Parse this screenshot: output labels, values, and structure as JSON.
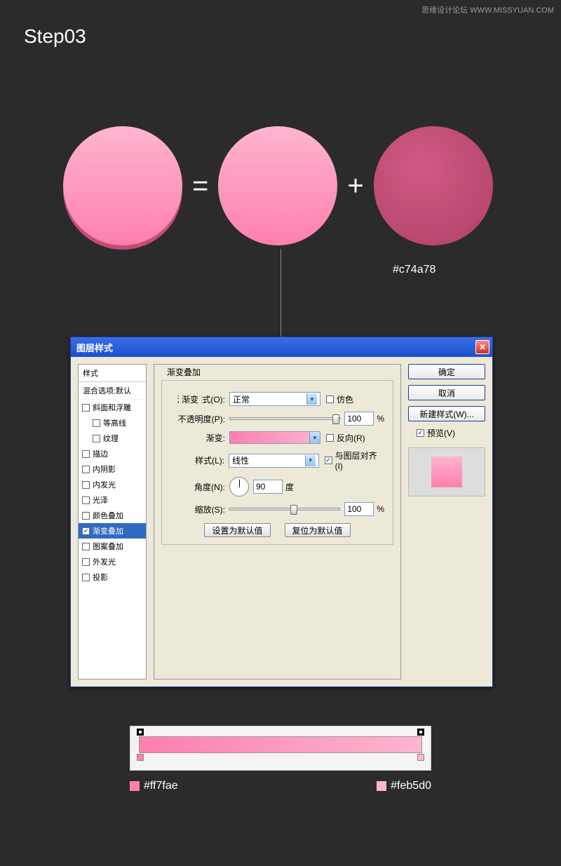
{
  "watermark": "思缘设计论坛 WWW.MISSYUAN.COM",
  "step_title": "Step03",
  "circle_color_label": "#c74a78",
  "operators": {
    "equals": "=",
    "plus": "+"
  },
  "dialog": {
    "title": "图层样式",
    "styles_header": "样式",
    "styles_sub": "混合选项:默认",
    "items": [
      {
        "label": "斜面和浮雕",
        "checked": false,
        "indent": false
      },
      {
        "label": "等高线",
        "checked": false,
        "indent": true
      },
      {
        "label": "纹理",
        "checked": false,
        "indent": true
      },
      {
        "label": "描边",
        "checked": false,
        "indent": false
      },
      {
        "label": "内阴影",
        "checked": false,
        "indent": false
      },
      {
        "label": "内发光",
        "checked": false,
        "indent": false
      },
      {
        "label": "光泽",
        "checked": false,
        "indent": false
      },
      {
        "label": "颜色叠加",
        "checked": false,
        "indent": false
      },
      {
        "label": "渐变叠加",
        "checked": true,
        "indent": false,
        "selected": true
      },
      {
        "label": "图案叠加",
        "checked": false,
        "indent": false
      },
      {
        "label": "外发光",
        "checked": false,
        "indent": false
      },
      {
        "label": "投影",
        "checked": false,
        "indent": false
      }
    ],
    "section_title": "渐变叠加",
    "subsection_title": "渐变",
    "blend_mode": {
      "label": "混合模式(O):",
      "value": "正常"
    },
    "dither": {
      "label": "仿色",
      "checked": false
    },
    "opacity": {
      "label": "不透明度(P):",
      "value": "100",
      "unit": "%"
    },
    "gradient_label": "渐变:",
    "reverse": {
      "label": "反向(R)",
      "checked": false
    },
    "style": {
      "label": "样式(L):",
      "value": "线性"
    },
    "align": {
      "label": "与图层对齐(I)",
      "checked": true
    },
    "angle": {
      "label": "角度(N):",
      "value": "90",
      "unit": "度"
    },
    "scale": {
      "label": "缩放(S):",
      "value": "100",
      "unit": "%"
    },
    "set_default": "设置为默认值",
    "reset_default": "复位为默认值",
    "ok": "确定",
    "cancel": "取消",
    "new_style": "新建样式(W)...",
    "preview": {
      "label": "预览(V)",
      "checked": true
    }
  },
  "gradient_stops": {
    "left": {
      "hex": "#ff7fae"
    },
    "right": {
      "hex": "#feb5d0"
    }
  }
}
